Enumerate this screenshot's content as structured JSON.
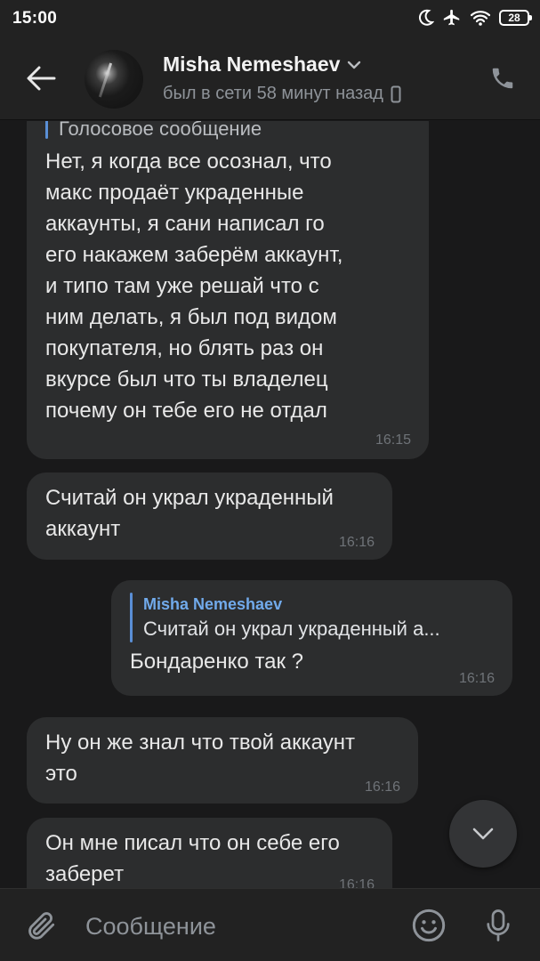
{
  "status_bar": {
    "time": "15:00",
    "battery": "28"
  },
  "header": {
    "name": "Misha Nemeshaev",
    "status": "был в сети 58 минут назад"
  },
  "messages": [
    {
      "voice_label": "Голосовое сообщение",
      "text": "Нет, я когда все осознал, что\nмакс продаёт украденные\nаккаунты, я сани написал го\nего накажем заберём аккаунт,\nи типо там уже решай что с\nним делать, я был под видом\nпокупателя, но блять раз он\nвкурсе был что ты владелец\nпочему он тебе его не отдал",
      "time": "16:15"
    },
    {
      "text": "Считай он украл украденный\nаккаунт",
      "time": "16:16"
    },
    {
      "reply_author": "Misha Nemeshaev",
      "reply_quote": "Считай он украл украденный а...",
      "text": "Бондаренко так ?",
      "time": "16:16"
    },
    {
      "text": "Ну он же знал что твой аккаунт\nэто",
      "time": "16:16"
    },
    {
      "text": "Он мне писал что он себе его\nзаберет",
      "time": "16:16"
    }
  ],
  "composer": {
    "placeholder": "Сообщение"
  },
  "colors": {
    "accent": "#71aaeb",
    "bubble": "#2c2d2e",
    "background": "#19191a",
    "bar": "#222222"
  }
}
